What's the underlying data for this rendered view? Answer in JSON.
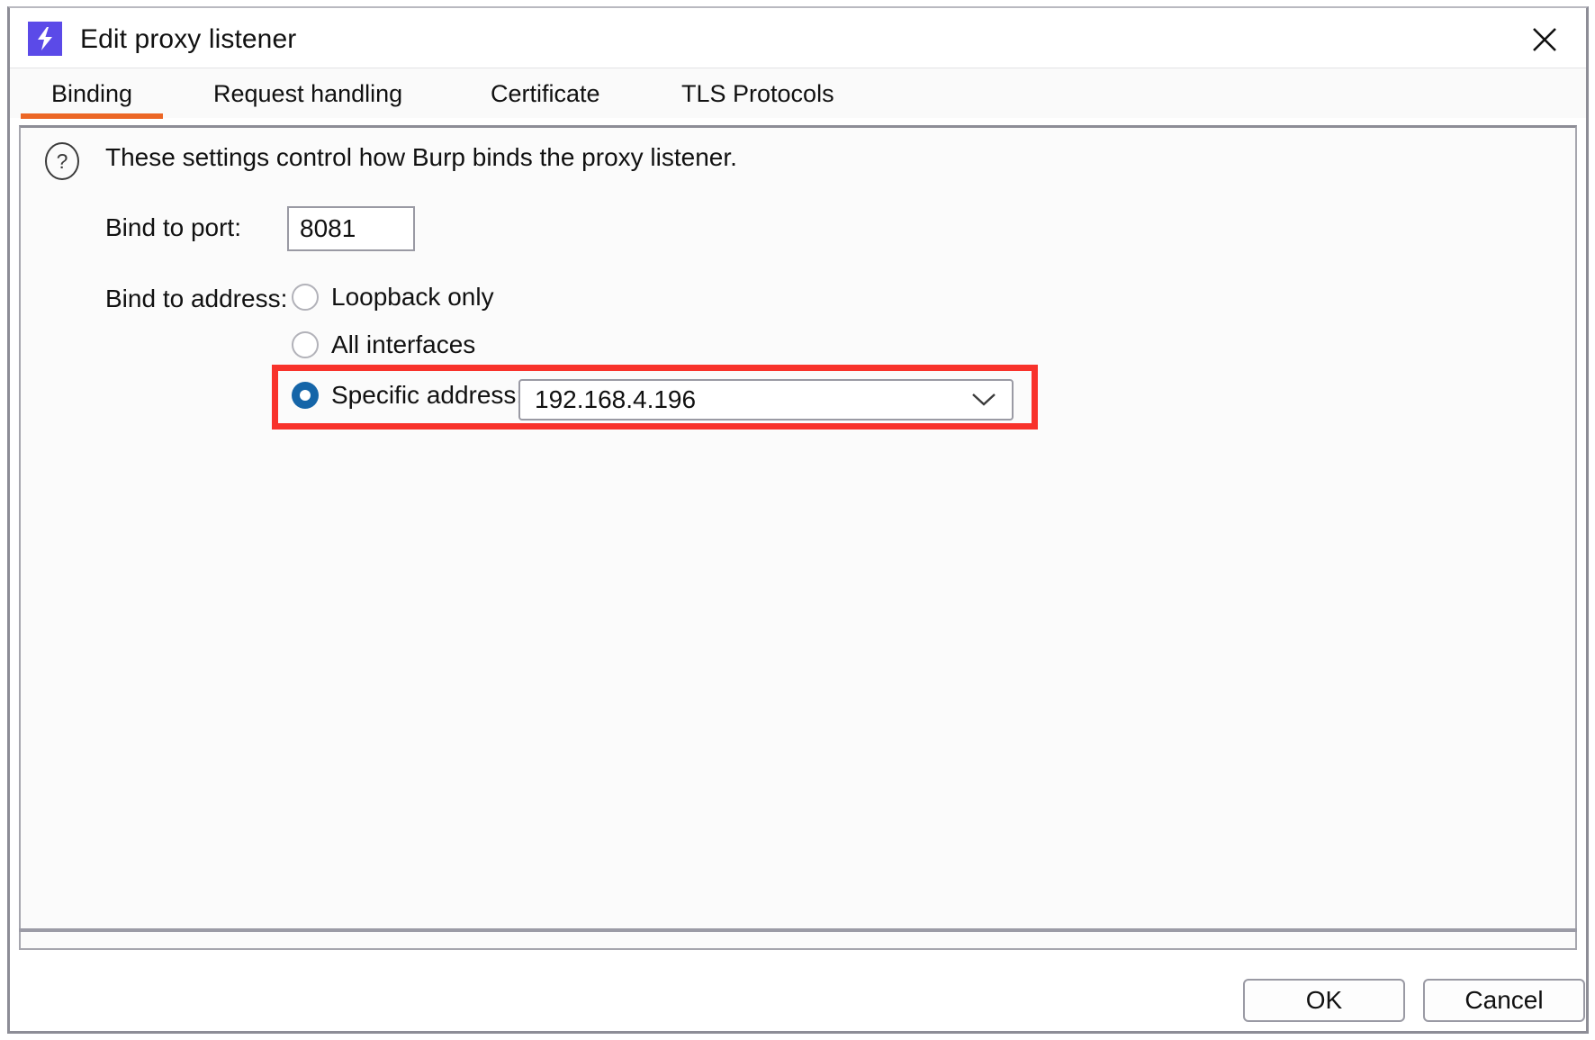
{
  "window": {
    "title": "Edit proxy listener",
    "app_icon": "lightning-bolt-icon",
    "close_icon": "close-icon",
    "brand_color": "#5b4ae8"
  },
  "tabs": {
    "active_index": 0,
    "accent_color": "#ec6625",
    "items": [
      {
        "label": "Binding"
      },
      {
        "label": "Request handling"
      },
      {
        "label": "Certificate"
      },
      {
        "label": "TLS Protocols"
      }
    ]
  },
  "binding": {
    "help_icon": "question-mark-icon",
    "intro": "These settings control how Burp binds the proxy listener.",
    "port": {
      "label": "Bind to port:",
      "value": "8081"
    },
    "address": {
      "label": "Bind to address:",
      "selected_index": 2,
      "options": [
        {
          "label": "Loopback only",
          "selected": false
        },
        {
          "label": "All interfaces",
          "selected": false
        },
        {
          "label": "Specific address:",
          "selected": true
        }
      ],
      "combo": {
        "value": "192.168.4.196",
        "caret_icon": "chevron-down-icon"
      }
    }
  },
  "annotation": {
    "color": "#f8322b",
    "target": "specific-address-row"
  },
  "footer": {
    "ok_label": "OK",
    "cancel_label": "Cancel"
  }
}
